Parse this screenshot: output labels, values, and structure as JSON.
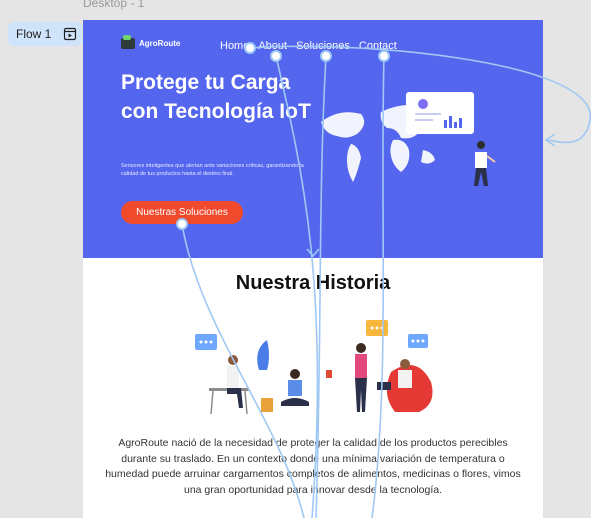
{
  "canvas": {
    "frame_label": "Desktop - 1",
    "flow_label": "Flow 1",
    "flow_icon": "play-frame-icon"
  },
  "site": {
    "brand": "AgroRoute",
    "nav": [
      "Home",
      "About",
      "Soluciones",
      "Contact"
    ],
    "hero_title": "Protege tu Carga con Tecnología IoT",
    "hero_description": "Sensores inteligentes que alertan ante variaciones críticas, garantizando la calidad de tus productos hasta el destino final.",
    "cta_label": "Nuestras Soluciones",
    "history_title": "Nuestra Historia",
    "history_text": "AgroRoute nació de la necesidad de proteger la calidad de  los productos perecibles durante su traslado. En un contexto donde una  mínima variación de temperatura o humedad puede arruinar cargamentos completos de alimentos, medicinas o flores, vimos una gran oportunidad para innovar desde la tecnología.",
    "colors": {
      "hero_bg": "#5566ee",
      "cta_bg": "#ef4a2c",
      "flow_line": "#9fc8f5"
    }
  }
}
